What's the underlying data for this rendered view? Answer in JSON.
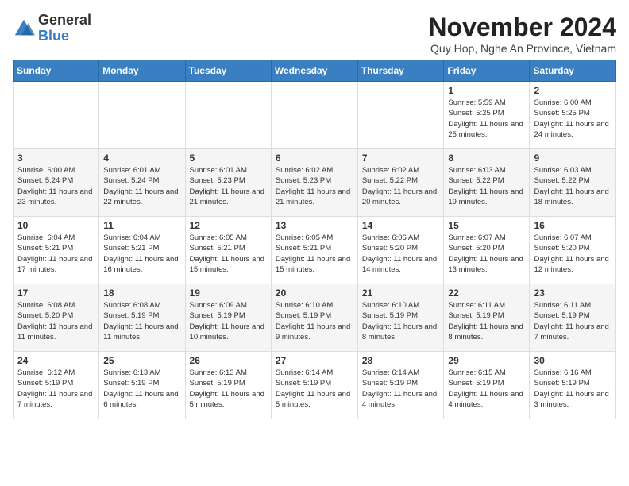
{
  "logo": {
    "general": "General",
    "blue": "Blue"
  },
  "title": "November 2024",
  "subtitle": "Quy Hop, Nghe An Province, Vietnam",
  "days_of_week": [
    "Sunday",
    "Monday",
    "Tuesday",
    "Wednesday",
    "Thursday",
    "Friday",
    "Saturday"
  ],
  "weeks": [
    [
      {
        "day": "",
        "info": ""
      },
      {
        "day": "",
        "info": ""
      },
      {
        "day": "",
        "info": ""
      },
      {
        "day": "",
        "info": ""
      },
      {
        "day": "",
        "info": ""
      },
      {
        "day": "1",
        "info": "Sunrise: 5:59 AM\nSunset: 5:25 PM\nDaylight: 11 hours and 25 minutes."
      },
      {
        "day": "2",
        "info": "Sunrise: 6:00 AM\nSunset: 5:25 PM\nDaylight: 11 hours and 24 minutes."
      }
    ],
    [
      {
        "day": "3",
        "info": "Sunrise: 6:00 AM\nSunset: 5:24 PM\nDaylight: 11 hours and 23 minutes."
      },
      {
        "day": "4",
        "info": "Sunrise: 6:01 AM\nSunset: 5:24 PM\nDaylight: 11 hours and 22 minutes."
      },
      {
        "day": "5",
        "info": "Sunrise: 6:01 AM\nSunset: 5:23 PM\nDaylight: 11 hours and 21 minutes."
      },
      {
        "day": "6",
        "info": "Sunrise: 6:02 AM\nSunset: 5:23 PM\nDaylight: 11 hours and 21 minutes."
      },
      {
        "day": "7",
        "info": "Sunrise: 6:02 AM\nSunset: 5:22 PM\nDaylight: 11 hours and 20 minutes."
      },
      {
        "day": "8",
        "info": "Sunrise: 6:03 AM\nSunset: 5:22 PM\nDaylight: 11 hours and 19 minutes."
      },
      {
        "day": "9",
        "info": "Sunrise: 6:03 AM\nSunset: 5:22 PM\nDaylight: 11 hours and 18 minutes."
      }
    ],
    [
      {
        "day": "10",
        "info": "Sunrise: 6:04 AM\nSunset: 5:21 PM\nDaylight: 11 hours and 17 minutes."
      },
      {
        "day": "11",
        "info": "Sunrise: 6:04 AM\nSunset: 5:21 PM\nDaylight: 11 hours and 16 minutes."
      },
      {
        "day": "12",
        "info": "Sunrise: 6:05 AM\nSunset: 5:21 PM\nDaylight: 11 hours and 15 minutes."
      },
      {
        "day": "13",
        "info": "Sunrise: 6:05 AM\nSunset: 5:21 PM\nDaylight: 11 hours and 15 minutes."
      },
      {
        "day": "14",
        "info": "Sunrise: 6:06 AM\nSunset: 5:20 PM\nDaylight: 11 hours and 14 minutes."
      },
      {
        "day": "15",
        "info": "Sunrise: 6:07 AM\nSunset: 5:20 PM\nDaylight: 11 hours and 13 minutes."
      },
      {
        "day": "16",
        "info": "Sunrise: 6:07 AM\nSunset: 5:20 PM\nDaylight: 11 hours and 12 minutes."
      }
    ],
    [
      {
        "day": "17",
        "info": "Sunrise: 6:08 AM\nSunset: 5:20 PM\nDaylight: 11 hours and 11 minutes."
      },
      {
        "day": "18",
        "info": "Sunrise: 6:08 AM\nSunset: 5:19 PM\nDaylight: 11 hours and 11 minutes."
      },
      {
        "day": "19",
        "info": "Sunrise: 6:09 AM\nSunset: 5:19 PM\nDaylight: 11 hours and 10 minutes."
      },
      {
        "day": "20",
        "info": "Sunrise: 6:10 AM\nSunset: 5:19 PM\nDaylight: 11 hours and 9 minutes."
      },
      {
        "day": "21",
        "info": "Sunrise: 6:10 AM\nSunset: 5:19 PM\nDaylight: 11 hours and 8 minutes."
      },
      {
        "day": "22",
        "info": "Sunrise: 6:11 AM\nSunset: 5:19 PM\nDaylight: 11 hours and 8 minutes."
      },
      {
        "day": "23",
        "info": "Sunrise: 6:11 AM\nSunset: 5:19 PM\nDaylight: 11 hours and 7 minutes."
      }
    ],
    [
      {
        "day": "24",
        "info": "Sunrise: 6:12 AM\nSunset: 5:19 PM\nDaylight: 11 hours and 7 minutes."
      },
      {
        "day": "25",
        "info": "Sunrise: 6:13 AM\nSunset: 5:19 PM\nDaylight: 11 hours and 6 minutes."
      },
      {
        "day": "26",
        "info": "Sunrise: 6:13 AM\nSunset: 5:19 PM\nDaylight: 11 hours and 5 minutes."
      },
      {
        "day": "27",
        "info": "Sunrise: 6:14 AM\nSunset: 5:19 PM\nDaylight: 11 hours and 5 minutes."
      },
      {
        "day": "28",
        "info": "Sunrise: 6:14 AM\nSunset: 5:19 PM\nDaylight: 11 hours and 4 minutes."
      },
      {
        "day": "29",
        "info": "Sunrise: 6:15 AM\nSunset: 5:19 PM\nDaylight: 11 hours and 4 minutes."
      },
      {
        "day": "30",
        "info": "Sunrise: 6:16 AM\nSunset: 5:19 PM\nDaylight: 11 hours and 3 minutes."
      }
    ]
  ]
}
